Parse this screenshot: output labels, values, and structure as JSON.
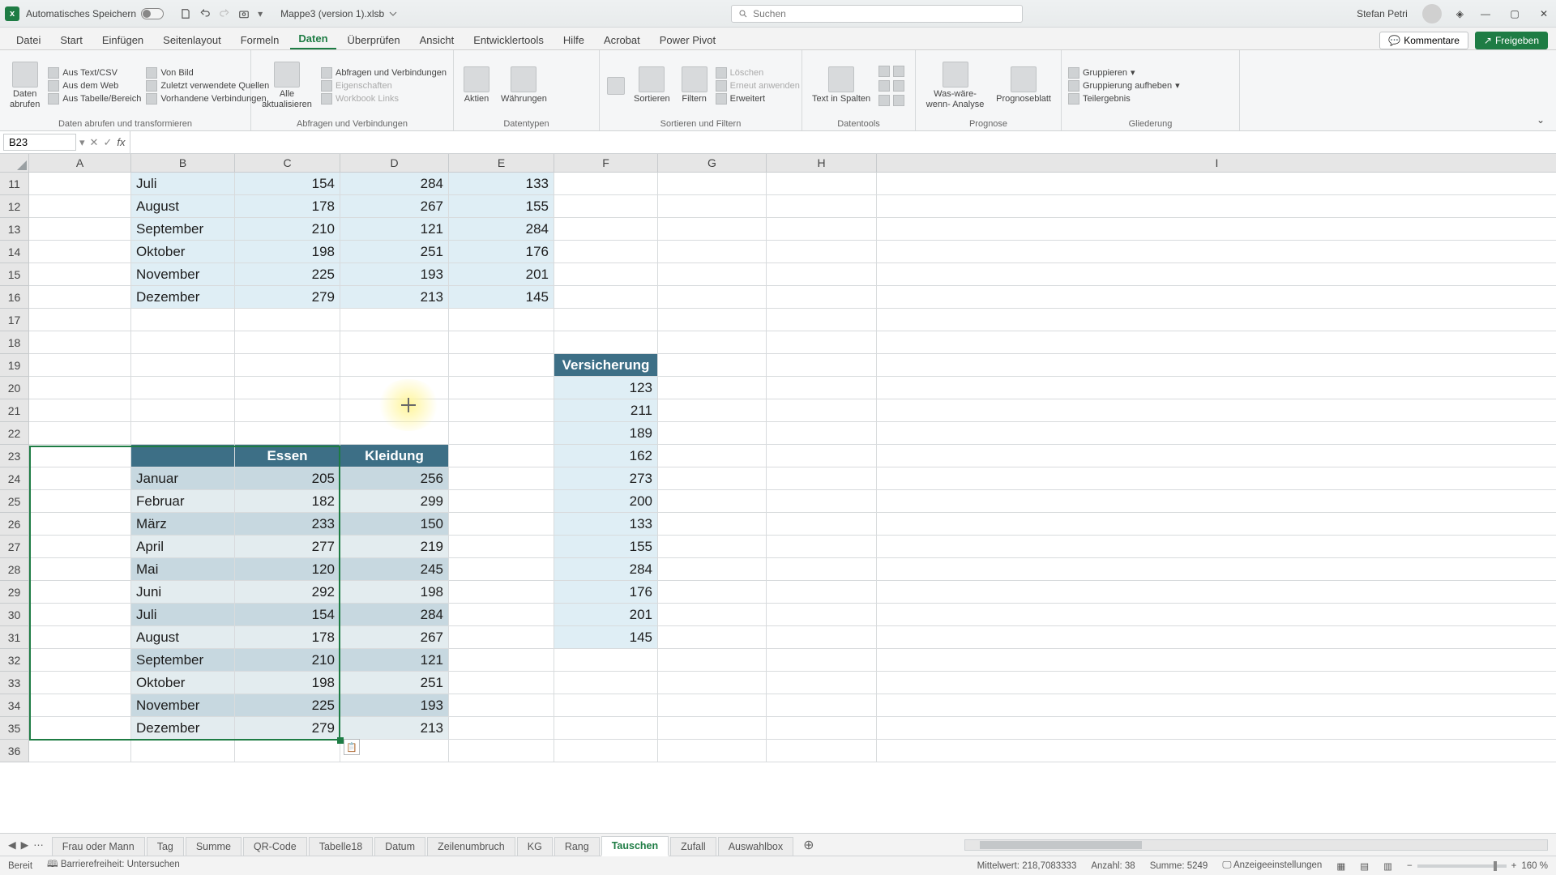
{
  "titlebar": {
    "autosave": "Automatisches Speichern",
    "filename": "Mappe3 (version 1).xlsb",
    "search_placeholder": "Suchen",
    "username": "Stefan Petri"
  },
  "menu": {
    "tabs": [
      "Datei",
      "Start",
      "Einfügen",
      "Seitenlayout",
      "Formeln",
      "Daten",
      "Überprüfen",
      "Ansicht",
      "Entwicklertools",
      "Hilfe",
      "Acrobat",
      "Power Pivot"
    ],
    "active": "Daten",
    "comments": "Kommentare",
    "share": "Freigeben"
  },
  "ribbon": {
    "g1": {
      "big": "Daten\nabrufen",
      "items": [
        "Aus Text/CSV",
        "Aus dem Web",
        "Aus Tabelle/Bereich",
        "Von Bild",
        "Zuletzt verwendete Quellen",
        "Vorhandene Verbindungen"
      ],
      "label": "Daten abrufen und transformieren"
    },
    "g2": {
      "big": "Alle\naktualisieren",
      "items": [
        "Abfragen und Verbindungen",
        "Eigenschaften",
        "Workbook Links"
      ],
      "label": "Abfragen und Verbindungen"
    },
    "g3": {
      "b1": "Aktien",
      "b2": "Währungen",
      "label": "Datentypen"
    },
    "g4": {
      "b1": "Sortieren",
      "b2": "Filtern",
      "items": [
        "Löschen",
        "Erneut anwenden",
        "Erweitert"
      ],
      "label": "Sortieren und Filtern"
    },
    "g5": {
      "big": "Text in\nSpalten",
      "label": "Datentools"
    },
    "g6": {
      "b1": "Was-wäre-wenn-\nAnalyse",
      "b2": "Prognoseblatt",
      "label": "Prognose"
    },
    "g7": {
      "items": [
        "Gruppieren",
        "Gruppierung aufheben",
        "Teilergebnis"
      ],
      "label": "Gliederung"
    }
  },
  "formula": {
    "namebox": "B23",
    "value": ""
  },
  "cols": [
    "A",
    "B",
    "C",
    "D",
    "E",
    "F",
    "G",
    "H",
    "I"
  ],
  "rows_start": 11,
  "rows_end": 36,
  "table1": {
    "rows": [
      {
        "r": 11,
        "m": "Juli",
        "c": 154,
        "d": 284,
        "e": 133
      },
      {
        "r": 12,
        "m": "August",
        "c": 178,
        "d": 267,
        "e": 155
      },
      {
        "r": 13,
        "m": "September",
        "c": 210,
        "d": 121,
        "e": 284
      },
      {
        "r": 14,
        "m": "Oktober",
        "c": 198,
        "d": 251,
        "e": 176
      },
      {
        "r": 15,
        "m": "November",
        "c": 225,
        "d": 193,
        "e": 201
      },
      {
        "r": 16,
        "m": "Dezember",
        "c": 279,
        "d": 213,
        "e": 145
      }
    ]
  },
  "insurance": {
    "header": "Versicherung",
    "vals": [
      123,
      211,
      189,
      162,
      273,
      200,
      133,
      155,
      284,
      176,
      201,
      145
    ]
  },
  "table2": {
    "hdr": [
      "",
      "Essen",
      "Kleidung"
    ],
    "rows": [
      {
        "m": "Januar",
        "c": 205,
        "d": 256
      },
      {
        "m": "Februar",
        "c": 182,
        "d": 299
      },
      {
        "m": "März",
        "c": 233,
        "d": 150
      },
      {
        "m": "April",
        "c": 277,
        "d": 219
      },
      {
        "m": "Mai",
        "c": 120,
        "d": 245
      },
      {
        "m": "Juni",
        "c": 292,
        "d": 198
      },
      {
        "m": "Juli",
        "c": 154,
        "d": 284
      },
      {
        "m": "August",
        "c": 178,
        "d": 267
      },
      {
        "m": "September",
        "c": 210,
        "d": 121
      },
      {
        "m": "Oktober",
        "c": 198,
        "d": 251
      },
      {
        "m": "November",
        "c": 225,
        "d": 193
      },
      {
        "m": "Dezember",
        "c": 279,
        "d": 213
      }
    ]
  },
  "sheets": {
    "tabs": [
      "Frau oder Mann",
      "Tag",
      "Summe",
      "QR-Code",
      "Tabelle18",
      "Datum",
      "Zeilenumbruch",
      "KG",
      "Rang",
      "Tauschen",
      "Zufall",
      "Auswahlbox"
    ],
    "active": "Tauschen"
  },
  "status": {
    "ready": "Bereit",
    "acc": "Barrierefreiheit: Untersuchen",
    "avg": "Mittelwert: 218,7083333",
    "cnt": "Anzahl: 38",
    "sum": "Summe: 5249",
    "disp": "Anzeigeeinstellungen",
    "zoom": "160 %"
  }
}
